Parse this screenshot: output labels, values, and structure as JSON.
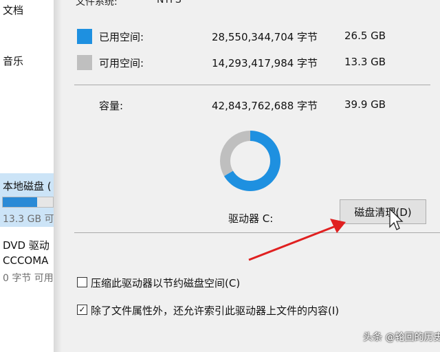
{
  "explorer": {
    "nav_items": [
      "文档",
      "音乐"
    ],
    "local_drive": {
      "name": "本地磁盘 (",
      "usage_fraction": 0.68,
      "free_text": "13.3 GB 可"
    },
    "dvd_drive": {
      "name": "DVD 驱动",
      "label": "CCCOMA",
      "free_text": "0 字节 可用"
    }
  },
  "dialog": {
    "filesystem": {
      "label": "文件系统:",
      "value": "NTFS"
    },
    "used": {
      "label": "已用空间:",
      "bytes": "28,550,344,704 字节",
      "gb": "26.5 GB",
      "color": "#1e90e0"
    },
    "free": {
      "label": "可用空间:",
      "bytes": "14,293,417,984 字节",
      "gb": "13.3 GB",
      "color": "#bfbfbf"
    },
    "capacity": {
      "label": "容量:",
      "bytes": "42,843,762,688 字节",
      "gb": "39.9 GB"
    },
    "drive_label": "驱动器 C:",
    "cleanup_button": "磁盘清理(D)",
    "compress_checkbox": {
      "label": "压缩此驱动器以节约磁盘空间(C)",
      "checked": false
    },
    "index_checkbox": {
      "label": "除了文件属性外，还允许索引此驱动器上文件的内容(I)",
      "checked": true,
      "mark": "✓"
    }
  },
  "chart_data": {
    "type": "pie",
    "categories": [
      "已用空间",
      "可用空间"
    ],
    "values": [
      28550344704,
      14293417984
    ],
    "colors": [
      "#1e90e0",
      "#bfbfbf"
    ]
  },
  "annotation": {
    "arrow_color": "#e02020"
  },
  "watermark": "头条 @轮回的历史"
}
